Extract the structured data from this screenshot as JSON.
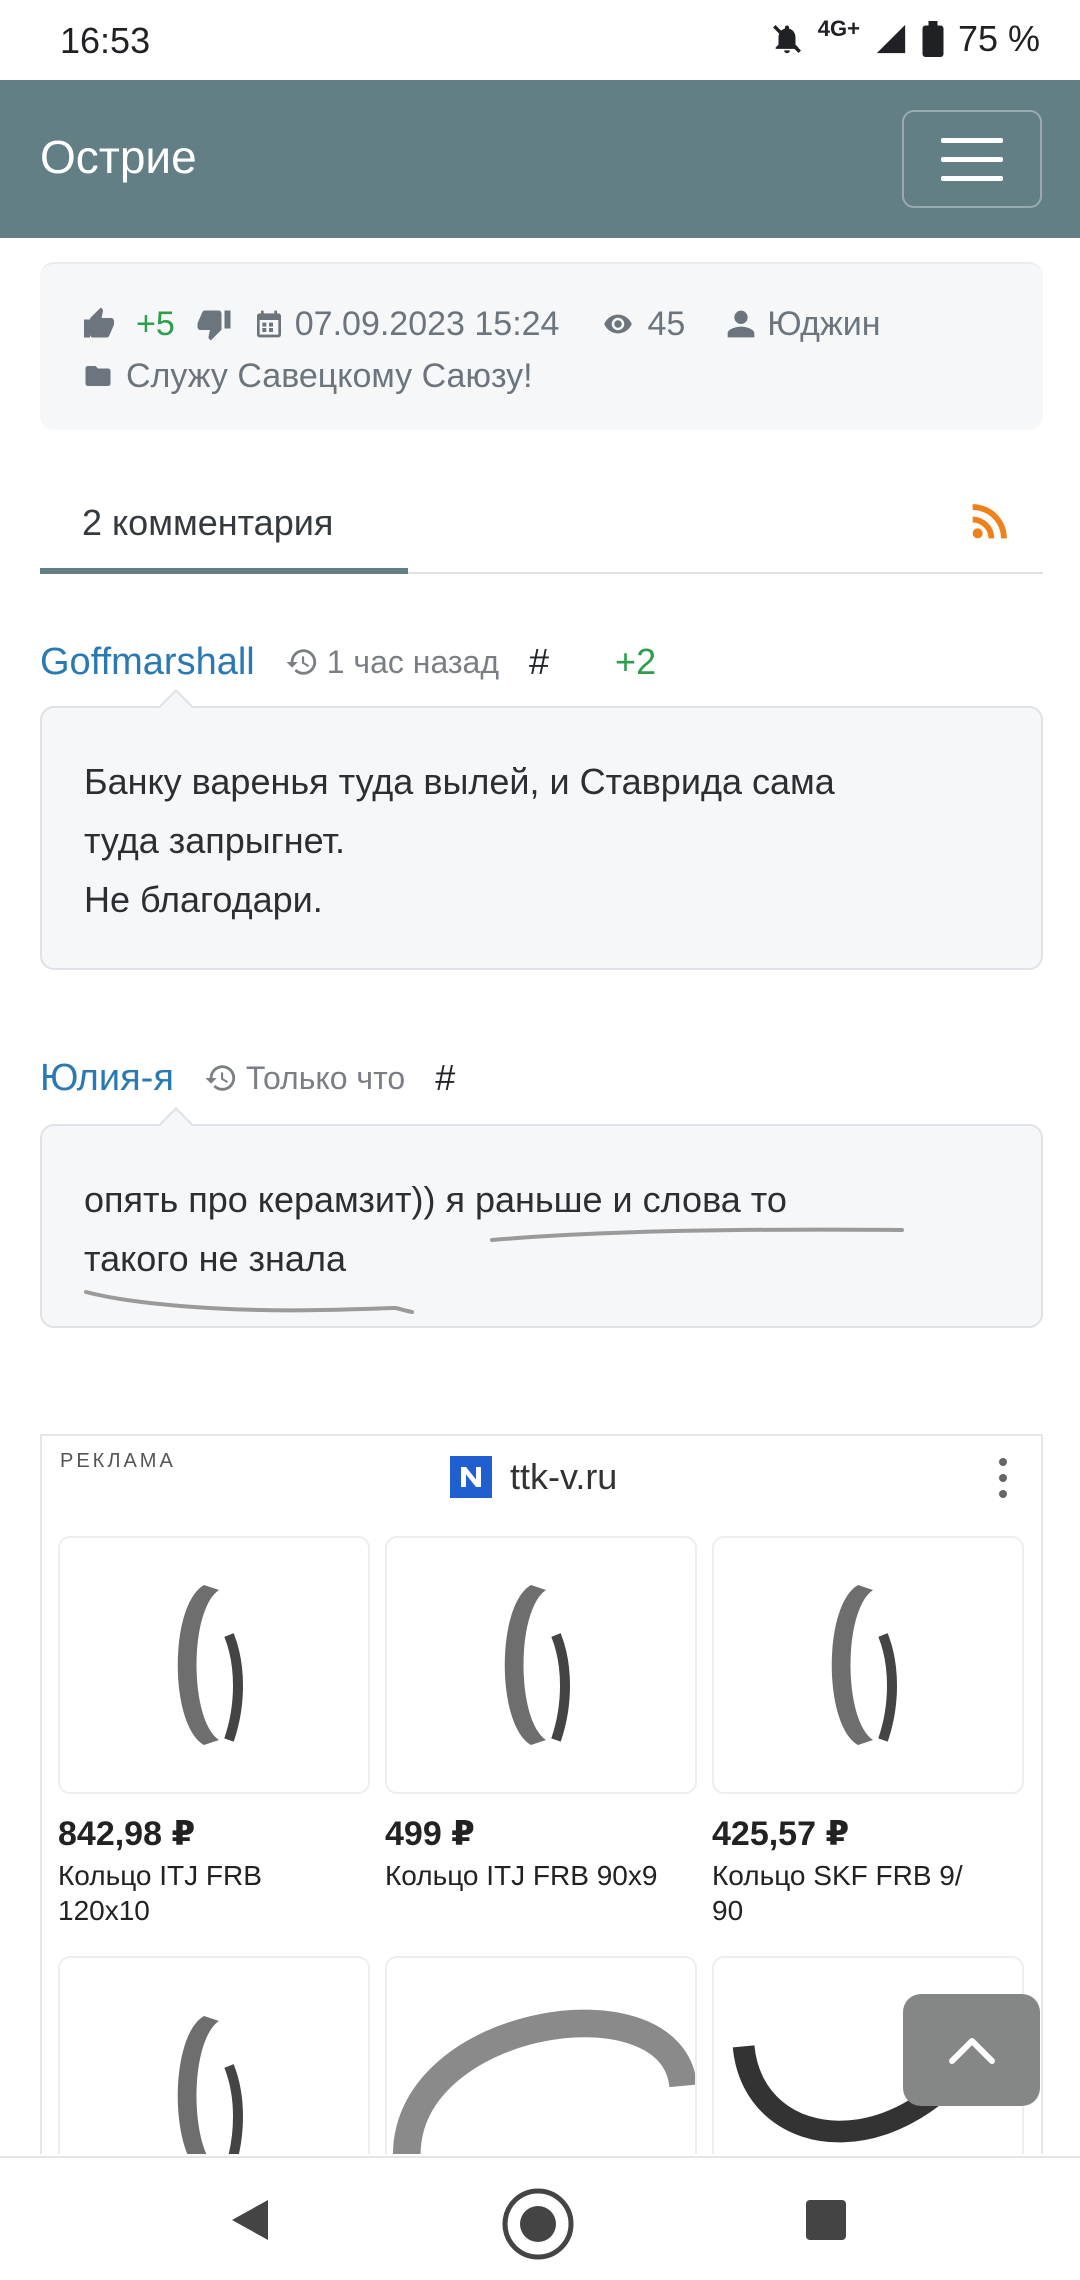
{
  "status_bar": {
    "time": "16:53",
    "network": "4G+",
    "battery": "75 %"
  },
  "app_bar": {
    "brand": "Острие"
  },
  "post_meta": {
    "likes": "+5",
    "date": "07.09.2023 15:24",
    "views": "45",
    "author": "Юджин",
    "category": "Служу Савецкому Саюзу!"
  },
  "tabs": {
    "comments_label": "2 комментария"
  },
  "comments": [
    {
      "author": "Goffmarshall",
      "time": "1 час назад",
      "hash": "#",
      "score": "+2",
      "lines": [
        "Банку варенья туда вылей, и Ставрида сама",
        "туда запрыгнет.",
        "Не благодари."
      ]
    },
    {
      "author": "Юлия-я",
      "time": "Только что",
      "hash": "#",
      "score": "",
      "lines": [
        "опять про керамзит)) я раньше и слова то",
        "такого не знала"
      ]
    }
  ],
  "ad": {
    "label": "РЕКЛАМА",
    "site": "ttk-v.ru",
    "products": [
      {
        "price": "842,98 ₽",
        "name_l1": "Кольцо ITJ FRB",
        "name_l2": "120x10"
      },
      {
        "price": "499 ₽",
        "name_l1": "Кольцо ITJ FRB 90x9",
        "name_l2": ""
      },
      {
        "price": "425,57 ₽",
        "name_l1": "Кольцо SKF FRB 9/",
        "name_l2": "90"
      }
    ]
  },
  "colors": {
    "appbar": "#637f86",
    "link": "#2a79b3",
    "positive": "#2e9d4c",
    "rss": "#f0801a"
  }
}
